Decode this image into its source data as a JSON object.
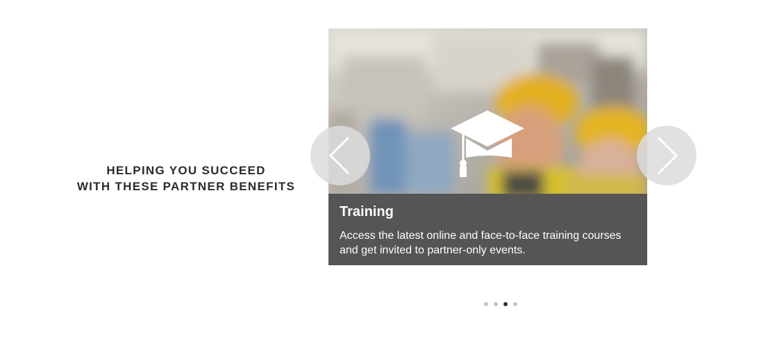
{
  "heading": {
    "line1": "HELPING YOU SUCCEED",
    "line2": "WITH THESE PARTNER BENEFITS"
  },
  "carousel": {
    "current_slide": {
      "title": "Training",
      "description": "Access the latest online and face-to-face training courses and get invited to partner-only events.",
      "icon": "graduation-cap-icon"
    },
    "prev_icon": "chevron-left-icon",
    "next_icon": "chevron-right-icon",
    "slide_count": 4,
    "active_index": 2
  },
  "colors": {
    "caption_bg": "#555555",
    "heading_text": "#2b2b2b",
    "dot_active": "#333333",
    "dot_inactive": "#c4c4c4",
    "helmet_yellow": "#e8b31e"
  }
}
